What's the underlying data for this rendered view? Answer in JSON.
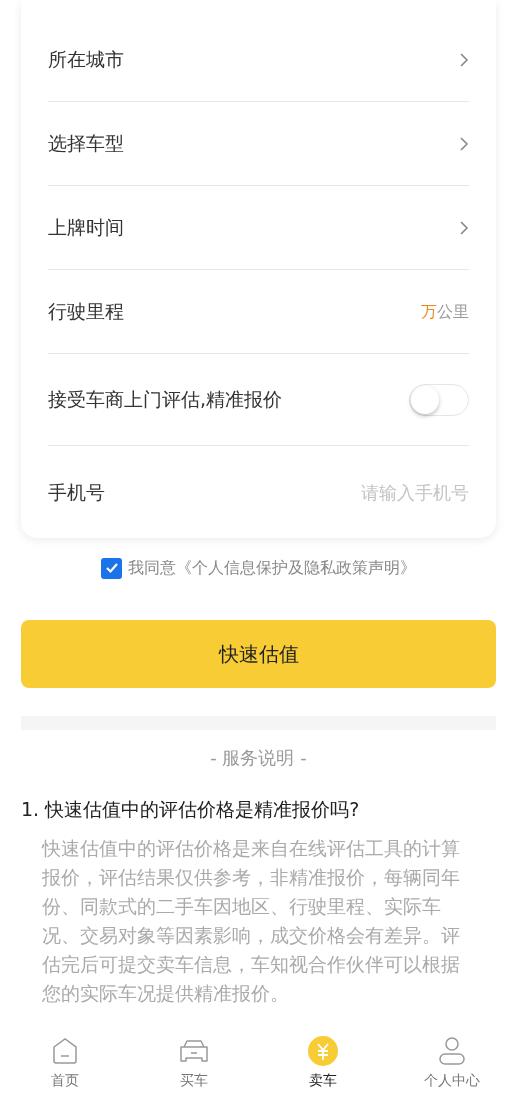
{
  "form": {
    "rows": [
      {
        "kind": "select",
        "label": "所在城市"
      },
      {
        "kind": "select",
        "label": "选择车型"
      },
      {
        "kind": "select",
        "label": "上牌时间"
      },
      {
        "kind": "mileage",
        "label": "行驶里程",
        "unit_prefix": "万",
        "unit": "公里"
      },
      {
        "kind": "toggle",
        "label": "接受车商上门评估,精准报价",
        "on": false
      },
      {
        "kind": "input",
        "label": "手机号",
        "placeholder": "请输入手机号"
      }
    ]
  },
  "agreement": {
    "checked": true,
    "text": "我同意《个人信息保护及隐私政策声明》"
  },
  "submit_button": "快速估值",
  "service": {
    "heading": "- 服务说明 -",
    "items": [
      {
        "question": "1. 快速估值中的评估价格是精准报价吗?",
        "answer": "快速估值中的评估价格是来自在线评估工具的计算报价，评估结果仅供参考，非精准报价，每辆同年份、同款式的二手车因地区、行驶里程、实际车况、交易对象等因素影响，成交价格会有差异。评估完后可提交卖车信息，车知视合作伙伴可以根据您的实际车况提供精准报价。"
      }
    ]
  },
  "tab_bar": [
    {
      "label": "首页",
      "selected": false
    },
    {
      "label": "买车",
      "selected": false
    },
    {
      "label": "卖车",
      "selected": true
    },
    {
      "label": "个人中心",
      "selected": false
    }
  ]
}
